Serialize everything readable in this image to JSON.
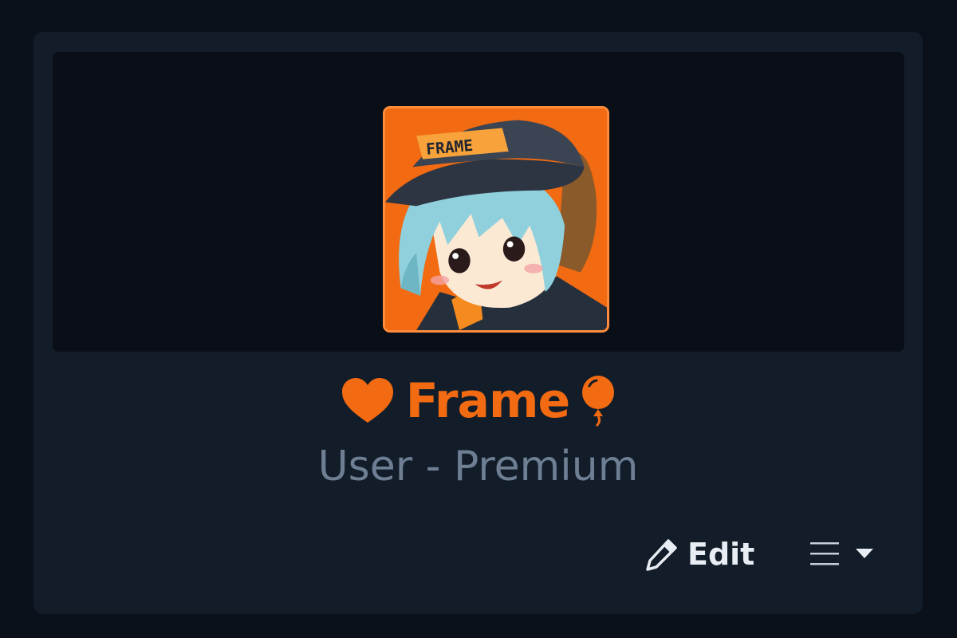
{
  "profile": {
    "username": "Frame",
    "user_title": "User - Premium",
    "avatar_badge_text": "FRAME"
  },
  "actions": {
    "edit_label": "Edit"
  },
  "icons": {
    "name_prefix": "heart-icon",
    "name_suffix": "balloon-icon",
    "edit": "pencil-icon",
    "menu": "hamburger-menu-icon",
    "dropdown": "caret-down-icon"
  },
  "colors": {
    "accent": "#f26a12",
    "card_background": "#121d29",
    "banner_background": "#0a0f17",
    "page_background": "#0b111a",
    "subtitle": "#6e7e93",
    "action_text": "#e8edf3"
  }
}
